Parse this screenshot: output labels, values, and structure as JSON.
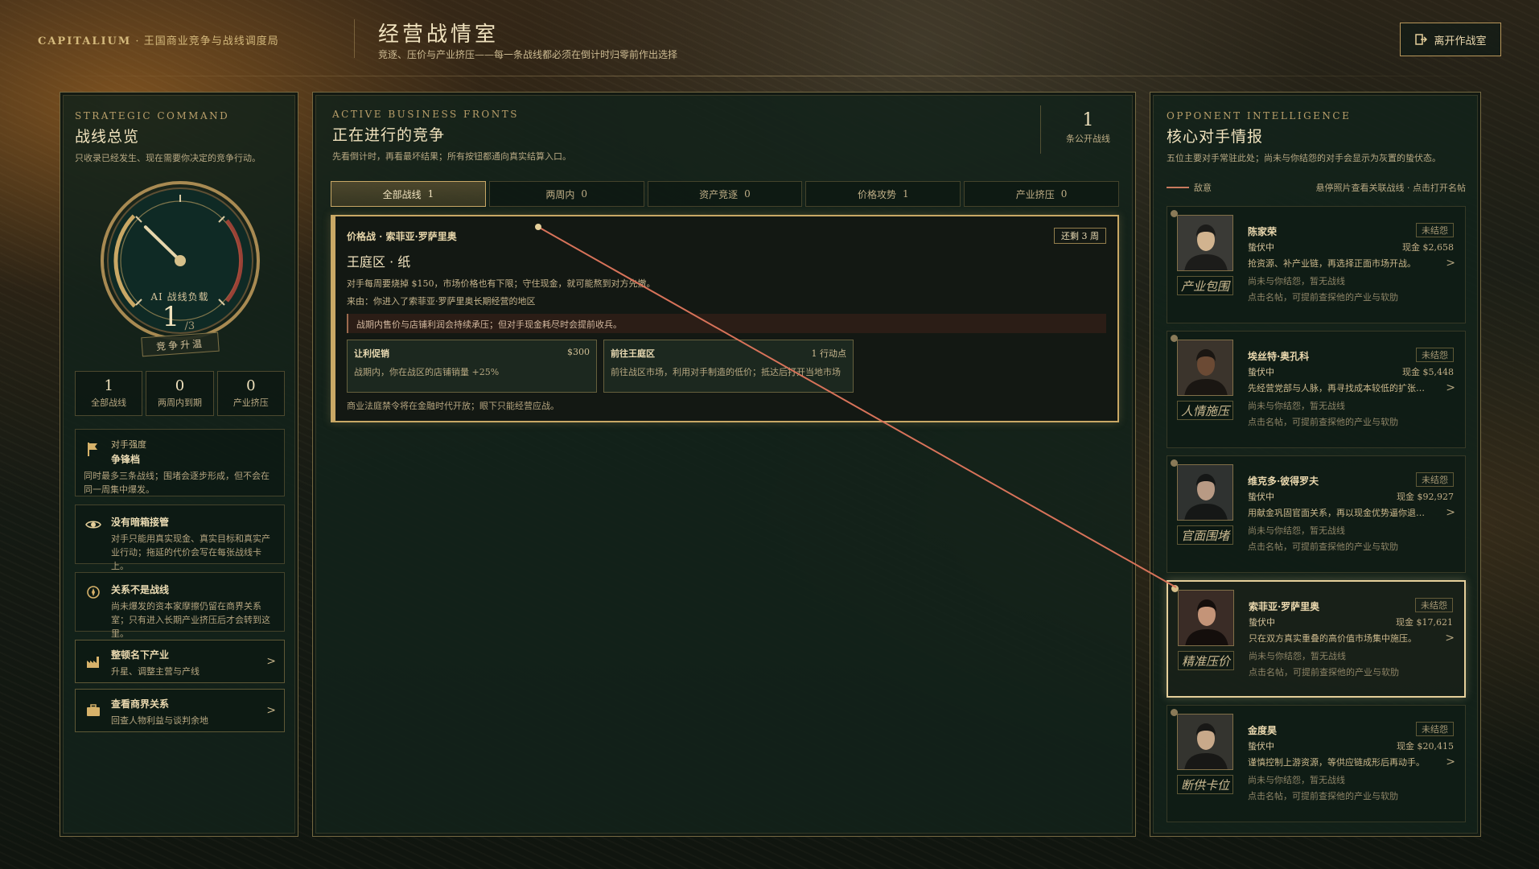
{
  "header": {
    "brand_name": "CAPITALIUM",
    "brand_tagline": " · 王国商业竞争与战线调度局",
    "title": "经营战情室",
    "subtitle": "竞逐、压价与产业挤压——每一条战线都必须在倒计时归零前作出选择",
    "exit_label": "离开作战室"
  },
  "left": {
    "eyebrow": "STRATEGIC COMMAND",
    "title": "战线总览",
    "desc": "只收录已经发生、现在需要你决定的竞争行动。",
    "gauge": {
      "label": "AI 战线负载",
      "value": "1",
      "max": "/3",
      "load_fraction": 0.33
    },
    "stage": "竞争升温",
    "stats": [
      {
        "num": "1",
        "label": "全部战线"
      },
      {
        "num": "0",
        "label": "两周内到期"
      },
      {
        "num": "0",
        "label": "产业挤压"
      }
    ],
    "cards": [
      {
        "icon": "flag-icon",
        "t1": "对手强度",
        "t2": "争锋档",
        "t3": "同时最多三条战线；围堵会逐步形成，但不会在同一周集中爆发。"
      },
      {
        "icon": "eye-icon",
        "t2": "没有暗箱接管",
        "t3": "对手只能用真实现金、真实目标和真实产业行动；拖延的代价会写在每张战线卡上。"
      },
      {
        "icon": "compass-icon",
        "t2": "关系不是战线",
        "t3": "尚未爆发的资本家摩擦仍留在商界关系室；只有进入长期产业挤压后才会转到这里。"
      }
    ],
    "nav": [
      {
        "icon": "factory-icon",
        "title": "整顿名下产业",
        "sub": "升星、调整主营与产线"
      },
      {
        "icon": "briefcase-icon",
        "title": "查看商界关系",
        "sub": "回查人物利益与谈判余地"
      }
    ]
  },
  "middle": {
    "eyebrow": "ACTIVE BUSINESS FRONTS",
    "title": "正在进行的竞争",
    "desc": "先看倒计时，再看最坏结果；所有按钮都通向真实结算入口。",
    "count": "1",
    "count_label": "条公开战线",
    "tabs": [
      {
        "label": "全部战线",
        "count": "1"
      },
      {
        "label": "两周内",
        "count": "0"
      },
      {
        "label": "资产竞逐",
        "count": "0"
      },
      {
        "label": "价格攻势",
        "count": "1"
      },
      {
        "label": "产业挤压",
        "count": "0"
      }
    ],
    "front": {
      "kind": "价格战 · 索菲亚·罗萨里奥",
      "time_left": "还剩 3 周",
      "region": "王庭区 · 纸",
      "text": "对手每周要烧掉 $150，市场价格也有下限；守住现金，就可能熬到对方先撤。",
      "from": "来由：你进入了索菲亚·罗萨里奥长期经营的地区",
      "warning": "战期内售价与店铺利润会持续承压；但对手现金耗尽时会提前收兵。",
      "actions": [
        {
          "name": "让利促销",
          "meta": "$300",
          "desc": "战期内，你在战区的店铺销量 +25%"
        },
        {
          "name": "前往王庭区",
          "meta": "1 行动点",
          "desc": "前往战区市场，利用对手制造的低价；抵达后打开当地市场"
        }
      ],
      "footer": "商业法庭禁令将在金融时代开放；眼下只能经营应战。"
    }
  },
  "right": {
    "eyebrow": "OPPONENT INTELLIGENCE",
    "title": "核心对手情报",
    "desc": "五位主要对手常驻此处；尚未与你结怨的对手会显示为灰置的蛰伏态。",
    "legend_label": "敌意",
    "legend_hint": "悬停照片查看关联战线 · 点击打开名帖",
    "opponents": [
      {
        "name": "陈家荣",
        "badge": "未结怨",
        "status": "蛰伏中",
        "cash": "现金 $2,658",
        "intent": "抢资源、补产业链，再选择正面市场开战。",
        "relation": "尚未与你结怨，暂无战线",
        "tip": "点击名帖，可提前查探他的产业与软肋",
        "tactic": "产业包围"
      },
      {
        "name": "埃丝特·奥孔科",
        "badge": "未结怨",
        "status": "蛰伏中",
        "cash": "现金 $5,448",
        "intent": "先经营党部与人脉，再寻找成本较低的扩张…",
        "relation": "尚未与你结怨，暂无战线",
        "tip": "点击名帖，可提前查探他的产业与软肋",
        "tactic": "人情施压"
      },
      {
        "name": "维克多·彼得罗夫",
        "badge": "未结怨",
        "status": "蛰伏中",
        "cash": "现金 $92,927",
        "intent": "用献金巩固官面关系，再以现金优势逼你退…",
        "relation": "尚未与你结怨，暂无战线",
        "tip": "点击名帖，可提前查探他的产业与软肋",
        "tactic": "官面围堵"
      },
      {
        "name": "索菲亚·罗萨里奥",
        "badge": "未结怨",
        "status": "蛰伏中",
        "cash": "现金 $17,621",
        "intent": "只在双方真实重叠的高价值市场集中施压。",
        "relation": "尚未与你结怨，暂无战线",
        "tip": "点击名帖，可提前查探他的产业与软肋",
        "tactic": "精准压价"
      },
      {
        "name": "金度昊",
        "badge": "未结怨",
        "status": "蛰伏中",
        "cash": "现金 $20,415",
        "intent": "谨慎控制上游资源，等供应链成形后再动手。",
        "relation": "尚未与你结怨，暂无战线",
        "tip": "点击名帖，可提前查探他的产业与软肋",
        "tactic": "断供卡位"
      }
    ]
  },
  "colors": {
    "accent": "#c9a865",
    "hostility_line": "#d8735a",
    "panel": "#12221a"
  }
}
